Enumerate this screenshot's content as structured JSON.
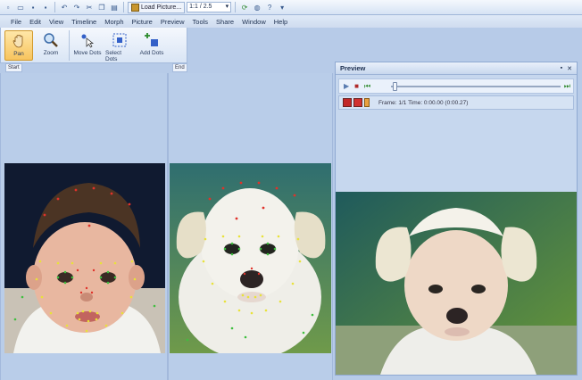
{
  "toolbar": {
    "load_picture_label": "Load Picture...",
    "zoom_value": "1:1 / 2.5"
  },
  "menu": [
    "File",
    "Edit",
    "View",
    "Timeline",
    "Morph",
    "Picture",
    "Preview",
    "Tools",
    "Share",
    "Window",
    "Help"
  ],
  "ribbon": {
    "tools": [
      {
        "label": "Pan",
        "icon": "hand-icon"
      },
      {
        "label": "Zoom",
        "icon": "magnifier-icon"
      },
      {
        "label": "Move Dots",
        "icon": "move-dots-icon"
      },
      {
        "label": "Select Dots",
        "icon": "select-dots-icon"
      },
      {
        "label": "Add Dots",
        "icon": "add-dots-icon"
      }
    ],
    "start_label": "Start",
    "end_label": "End"
  },
  "preview": {
    "title": "Preview",
    "frame_text": "Frame: 1/1 Time: 0:00.00 (0:00.27)"
  },
  "colors": {
    "accent": "#f7c45e",
    "panel_bg": "#b9cde9",
    "dot_red": "#e0322a",
    "dot_yellow": "#e8e23a",
    "dot_green": "#3fbf3f"
  }
}
